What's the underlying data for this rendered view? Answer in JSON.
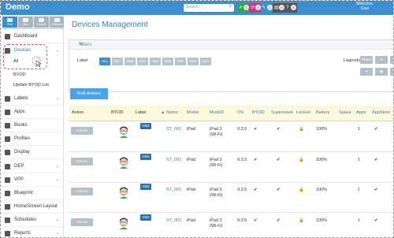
{
  "app": {
    "title": "Demo"
  },
  "header": {
    "search_placeholder": "Search ...",
    "welcome_line1": "Welcome,",
    "welcome_line2": "User",
    "buttons": [
      {
        "icon": "check-icon",
        "count": "1",
        "color": "#2eaa4a"
      },
      {
        "icon": "refresh-icon",
        "count": "4",
        "color": "#d0338a"
      },
      {
        "icon": "bolt-icon",
        "count": "1",
        "color": "#3b8fd0"
      },
      {
        "icon": "inbox-icon",
        "count": "0",
        "color": "#555555"
      },
      {
        "icon": "help-icon",
        "count": "0",
        "color": "#555555"
      }
    ]
  },
  "subbar": {
    "buttons": [
      {
        "label": "iPad"
      },
      {
        "label": "Mac"
      },
      {
        "label": "Android"
      },
      {
        "label": "Windows"
      }
    ]
  },
  "sidebar": {
    "dashboard": "Dashboard",
    "devices": "Devices",
    "all": "All",
    "byod": "BYOD",
    "update_byod": "Update BYOD List",
    "items": [
      {
        "label": "Labels",
        "icon": "tag-icon",
        "chevron": true
      },
      {
        "label": "Apps",
        "icon": "apps-icon",
        "chevron": false
      },
      {
        "label": "Books",
        "icon": "book-icon",
        "chevron": false
      },
      {
        "label": "Profiles",
        "icon": "profile-icon",
        "chevron": false
      },
      {
        "label": "Display",
        "icon": "display-icon",
        "chevron": false
      },
      {
        "label": "DEP",
        "icon": "dep-icon",
        "chevron": true
      },
      {
        "label": "VPP",
        "icon": "vpp-icon",
        "chevron": true
      },
      {
        "label": "Blueprint",
        "icon": "blueprint-icon",
        "chevron": false
      },
      {
        "label": "HomeScreen Layout",
        "icon": "layout-icon",
        "chevron": false
      },
      {
        "label": "Schedules",
        "icon": "clock-icon",
        "chevron": true
      },
      {
        "label": "Reports",
        "icon": "report-icon",
        "chevron": true
      }
    ]
  },
  "main": {
    "title": "Devices Management",
    "filters_label": "Filters",
    "label_text": "Label",
    "label_chips": [
      "ALL",
      "G6A",
      "G6B",
      "G6C",
      "G6D",
      "G6E",
      "G6F",
      "G6G",
      "G6H"
    ],
    "legends_text": "Legends",
    "legend_buttons_row1": [
      "Reset",
      "✔",
      "✎"
    ],
    "legend_buttons_row2": [
      "➜",
      "▣",
      "⟳"
    ],
    "actions_button": "Bulk Actions"
  },
  "table": {
    "headers": [
      "Action",
      "BYOD",
      "Label",
      "Name",
      "Model",
      "Model2",
      "OS",
      "BYOD",
      "Supervised",
      "Locked",
      "Battery",
      "Space",
      "Apps",
      "AppStore"
    ],
    "rows": [
      {
        "action": "Actions",
        "label": "G6D",
        "name": "ST_001",
        "model": "iPad",
        "model2_line1": "iPad 3",
        "model2_line2": "(Wi-Fi)",
        "os": "9.3.5",
        "byod": "✔",
        "supervised": "✔",
        "locked": "🔒",
        "battery": "100%",
        "space": "",
        "apps": "1",
        "appstore": "✔"
      },
      {
        "action": "Actions",
        "label": "G6D",
        "name": "ST_001",
        "model": "iPad",
        "model2_line1": "iPad 3",
        "model2_line2": "(Wi-Fi)",
        "os": "9.3.5",
        "byod": "✔",
        "supervised": "✔",
        "locked": "🔒",
        "battery": "100%",
        "space": "",
        "apps": "1",
        "appstore": "✔"
      },
      {
        "action": "Actions",
        "label": "G6D",
        "name": "ST_001",
        "model": "iPad",
        "model2_line1": "iPad 3",
        "model2_line2": "(Wi-Fi)",
        "os": "9.3.5",
        "byod": "✔",
        "supervised": "✔",
        "locked": "🔒",
        "battery": "100%",
        "space": "",
        "apps": "1",
        "appstore": "✔"
      },
      {
        "action": "Actions",
        "label": "G6D",
        "name": "ST_001",
        "model": "iPad",
        "model2_line1": "iPad 3",
        "model2_line2": "(Wi-Fi)",
        "os": "9.3.5",
        "byod": "✔",
        "supervised": "✔",
        "locked": "🔒",
        "battery": "100%",
        "space": "",
        "apps": "1",
        "appstore": "✔"
      }
    ]
  }
}
